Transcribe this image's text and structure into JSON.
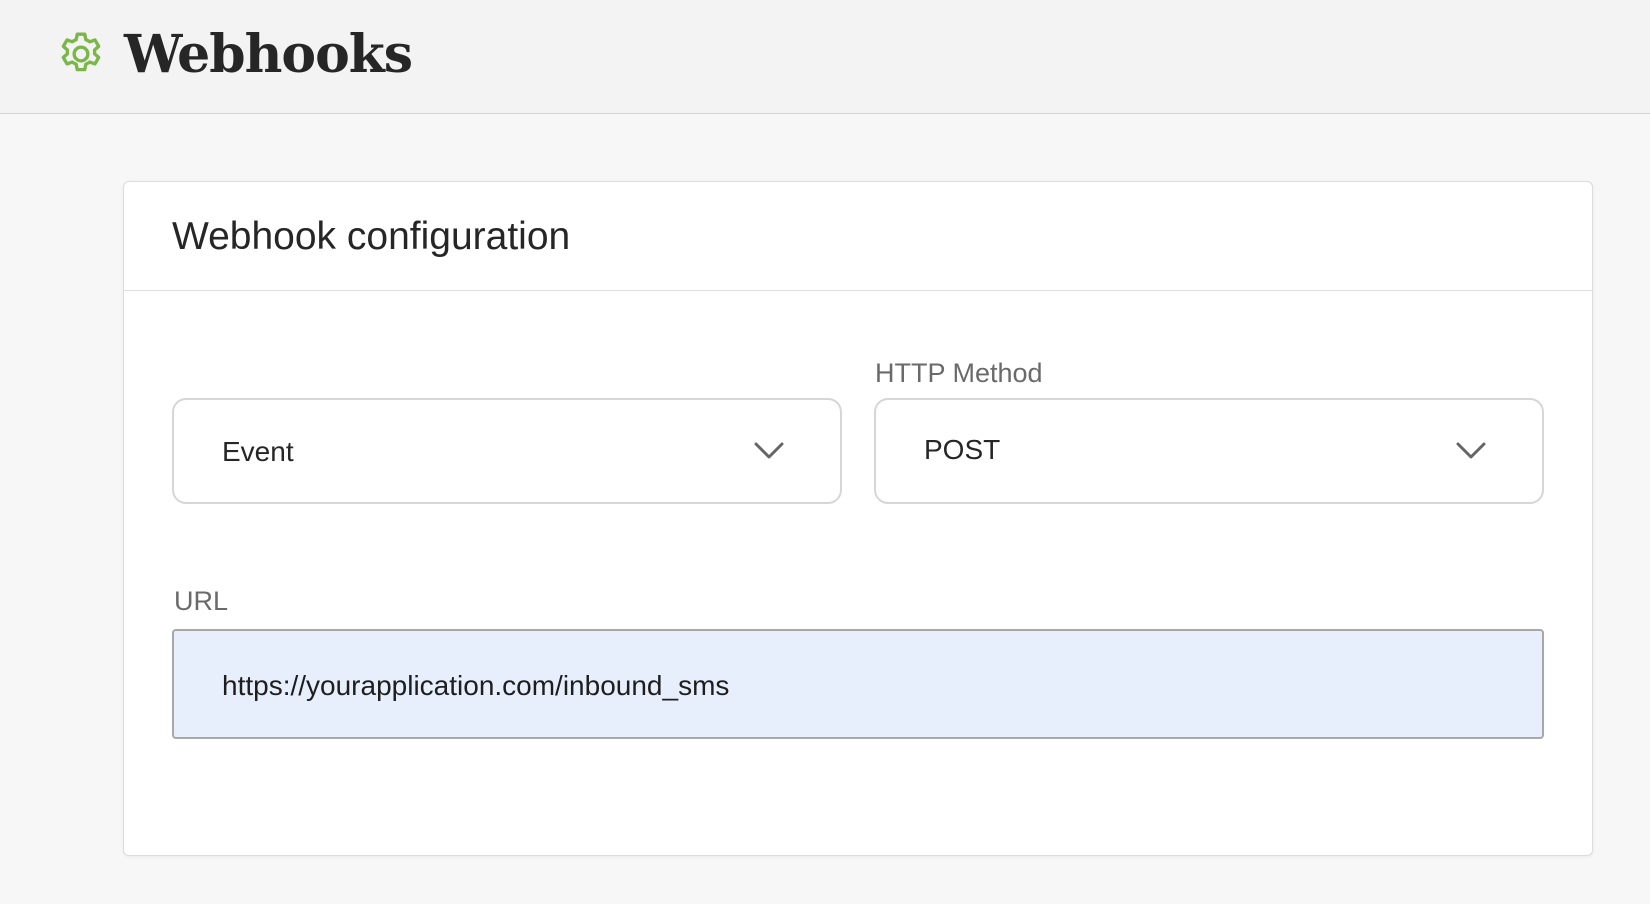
{
  "header": {
    "title": "Webhooks",
    "icon": "gear-icon",
    "icon_color": "#7ab648"
  },
  "card": {
    "title": "Webhook configuration",
    "event_select": {
      "label": "",
      "value": "Event"
    },
    "method_select": {
      "label": "HTTP Method",
      "value": "POST"
    },
    "url_field": {
      "label": "URL",
      "value": "https://yourapplication.com/inbound_sms",
      "background": "#e8effc"
    }
  }
}
